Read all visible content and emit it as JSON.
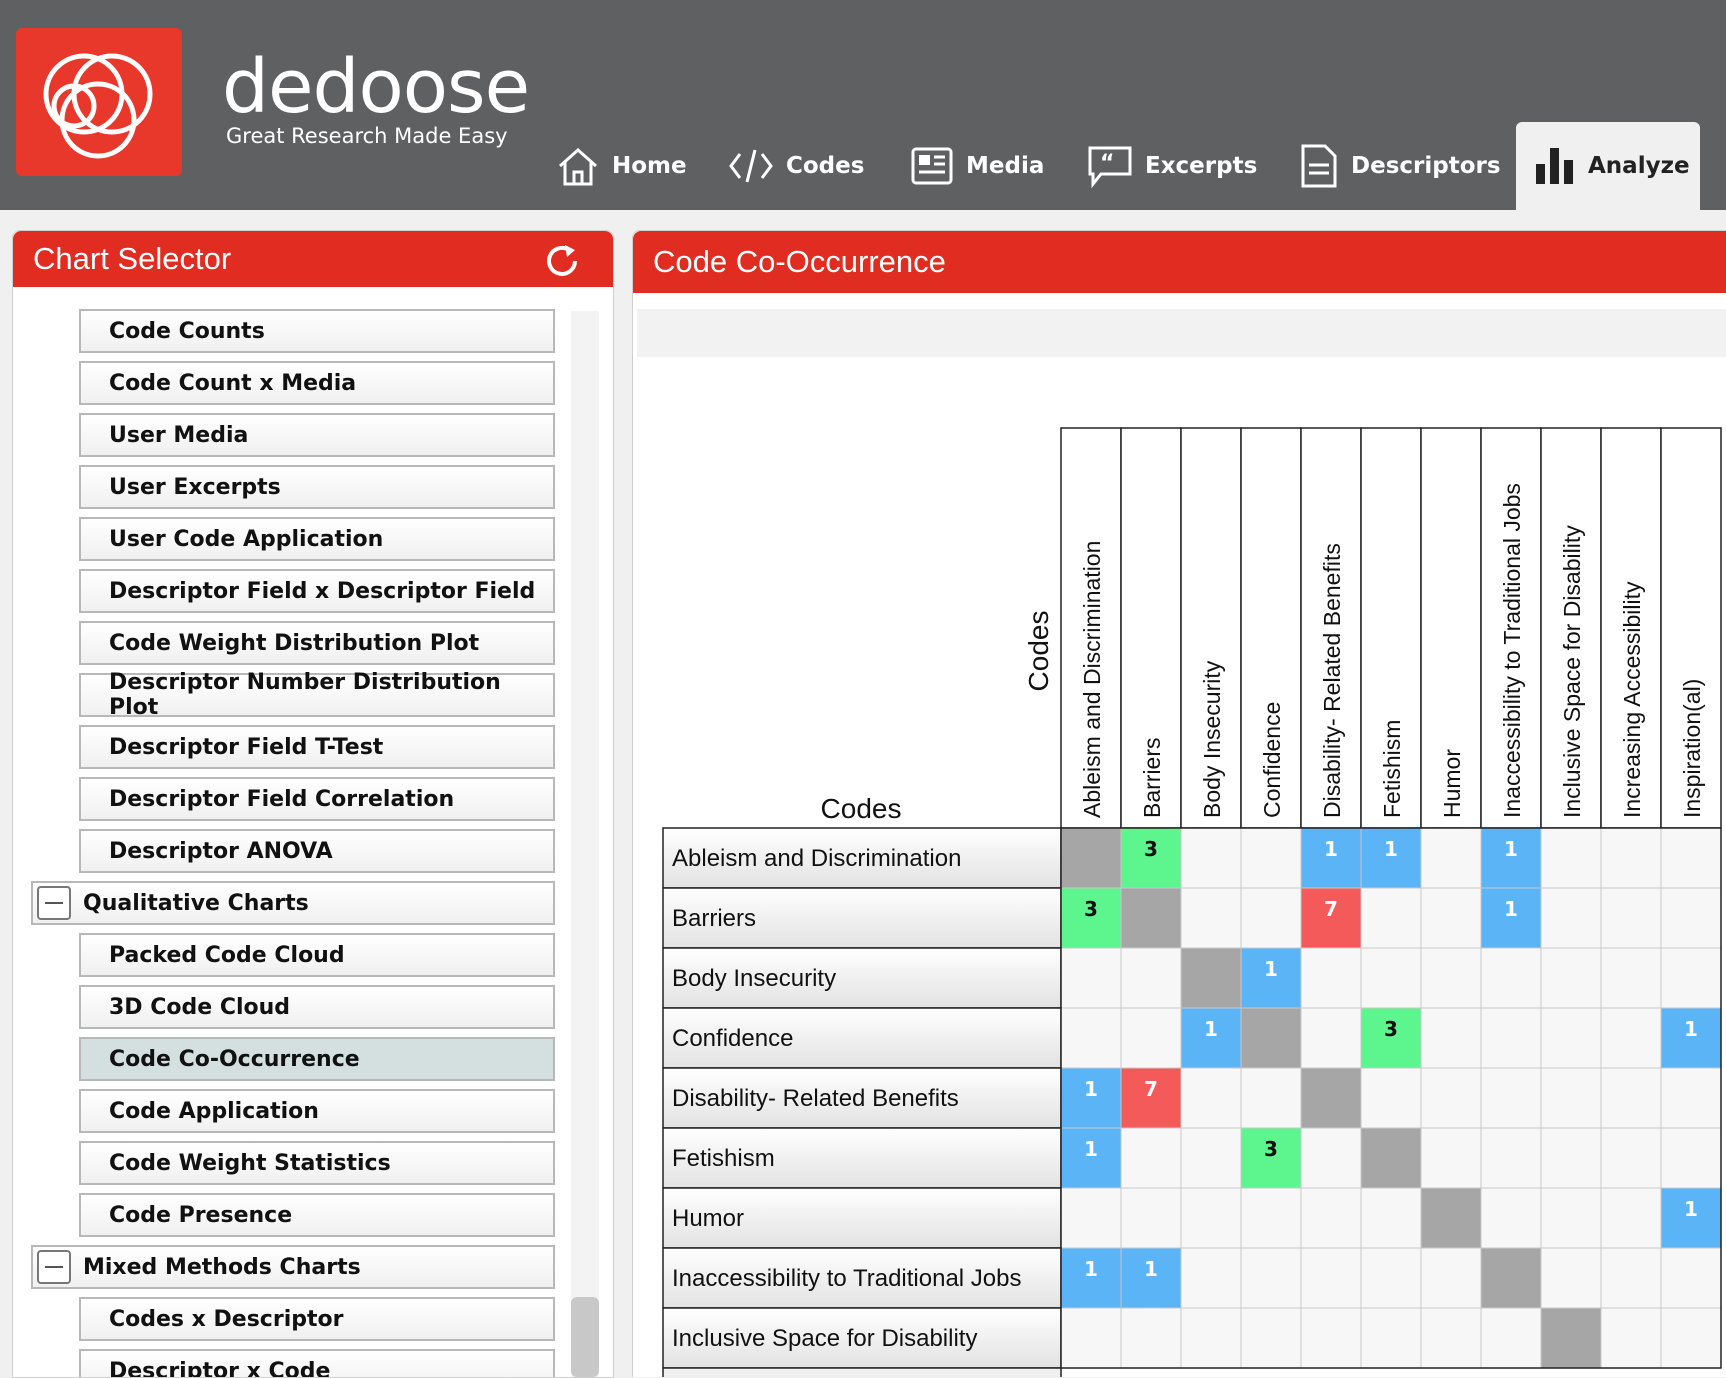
{
  "app": {
    "brand": "dedoose",
    "tagline": "Great Research Made Easy",
    "colors": {
      "brand_red": "#e12c21",
      "topbar": "#5f6062"
    }
  },
  "nav": [
    {
      "label": "Home",
      "icon": "home-icon"
    },
    {
      "label": "Codes",
      "icon": "code-icon"
    },
    {
      "label": "Media",
      "icon": "media-icon"
    },
    {
      "label": "Excerpts",
      "icon": "quote-icon"
    },
    {
      "label": "Descriptors",
      "icon": "document-icon"
    },
    {
      "label": "Analyze",
      "icon": "bar-chart-icon",
      "active": true
    }
  ],
  "chart_selector": {
    "title": "Chart Selector",
    "items": [
      {
        "label": "Code Counts",
        "type": "chart"
      },
      {
        "label": "Code Count x Media",
        "type": "chart"
      },
      {
        "label": "User Media",
        "type": "chart"
      },
      {
        "label": "User Excerpts",
        "type": "chart"
      },
      {
        "label": "User Code Application",
        "type": "chart"
      },
      {
        "label": "Descriptor Field x Descriptor Field",
        "type": "chart"
      },
      {
        "label": "Code Weight Distribution Plot",
        "type": "chart"
      },
      {
        "label": "Descriptor Number Distribution Plot",
        "type": "chart"
      },
      {
        "label": "Descriptor Field T-Test",
        "type": "chart"
      },
      {
        "label": "Descriptor Field Correlation",
        "type": "chart"
      },
      {
        "label": "Descriptor ANOVA",
        "type": "chart"
      },
      {
        "label": "Qualitative Charts",
        "type": "group"
      },
      {
        "label": "Packed Code Cloud",
        "type": "chart"
      },
      {
        "label": "3D Code Cloud",
        "type": "chart"
      },
      {
        "label": "Code Co-Occurrence",
        "type": "chart",
        "selected": true
      },
      {
        "label": "Code Application",
        "type": "chart"
      },
      {
        "label": "Code Weight Statistics",
        "type": "chart"
      },
      {
        "label": "Code Presence",
        "type": "chart"
      },
      {
        "label": "Mixed Methods Charts",
        "type": "group"
      },
      {
        "label": "Codes x Descriptor",
        "type": "chart"
      },
      {
        "label": "Descriptor x Code",
        "type": "chart"
      }
    ]
  },
  "main": {
    "title": "Code Co-Occurrence"
  },
  "chart_data": {
    "type": "heatmap",
    "row_header": "Codes",
    "column_header": "Codes",
    "columns": [
      "Ableism and Discrimination",
      "Barriers",
      "Body Insecurity",
      "Confidence",
      "Disability- Related Benefits",
      "Fetishism",
      "Humor",
      "Inaccessibility to Traditional Jobs",
      "Inclusive Space for Disability",
      "Increasing Accessibility",
      "Inspiration(al)"
    ],
    "rows": [
      "Ableism and Discrimination",
      "Barriers",
      "Body Insecurity",
      "Confidence",
      "Disability- Related Benefits",
      "Fetishism",
      "Humor",
      "Inaccessibility to Traditional Jobs",
      "Inclusive Space for Disability"
    ],
    "values": [
      [
        null,
        3,
        0,
        0,
        1,
        1,
        0,
        1,
        0,
        0,
        0
      ],
      [
        3,
        null,
        0,
        0,
        7,
        0,
        0,
        1,
        0,
        0,
        0
      ],
      [
        0,
        0,
        null,
        1,
        0,
        0,
        0,
        0,
        0,
        0,
        0
      ],
      [
        0,
        0,
        1,
        null,
        0,
        3,
        0,
        0,
        0,
        0,
        1
      ],
      [
        1,
        7,
        0,
        0,
        null,
        0,
        0,
        0,
        0,
        0,
        0
      ],
      [
        1,
        0,
        0,
        3,
        0,
        null,
        0,
        0,
        0,
        0,
        0
      ],
      [
        0,
        0,
        0,
        0,
        0,
        0,
        null,
        0,
        0,
        0,
        1
      ],
      [
        1,
        1,
        0,
        0,
        0,
        0,
        0,
        null,
        0,
        0,
        0
      ],
      [
        0,
        0,
        0,
        0,
        0,
        0,
        0,
        0,
        null,
        0,
        0
      ]
    ],
    "color_scale": {
      "1": "#5ab4f5",
      "3": "#5df58d",
      "7": "#f55a5a",
      "diagonal": "#a6a6a6",
      "empty": "#f7f7f7"
    }
  }
}
